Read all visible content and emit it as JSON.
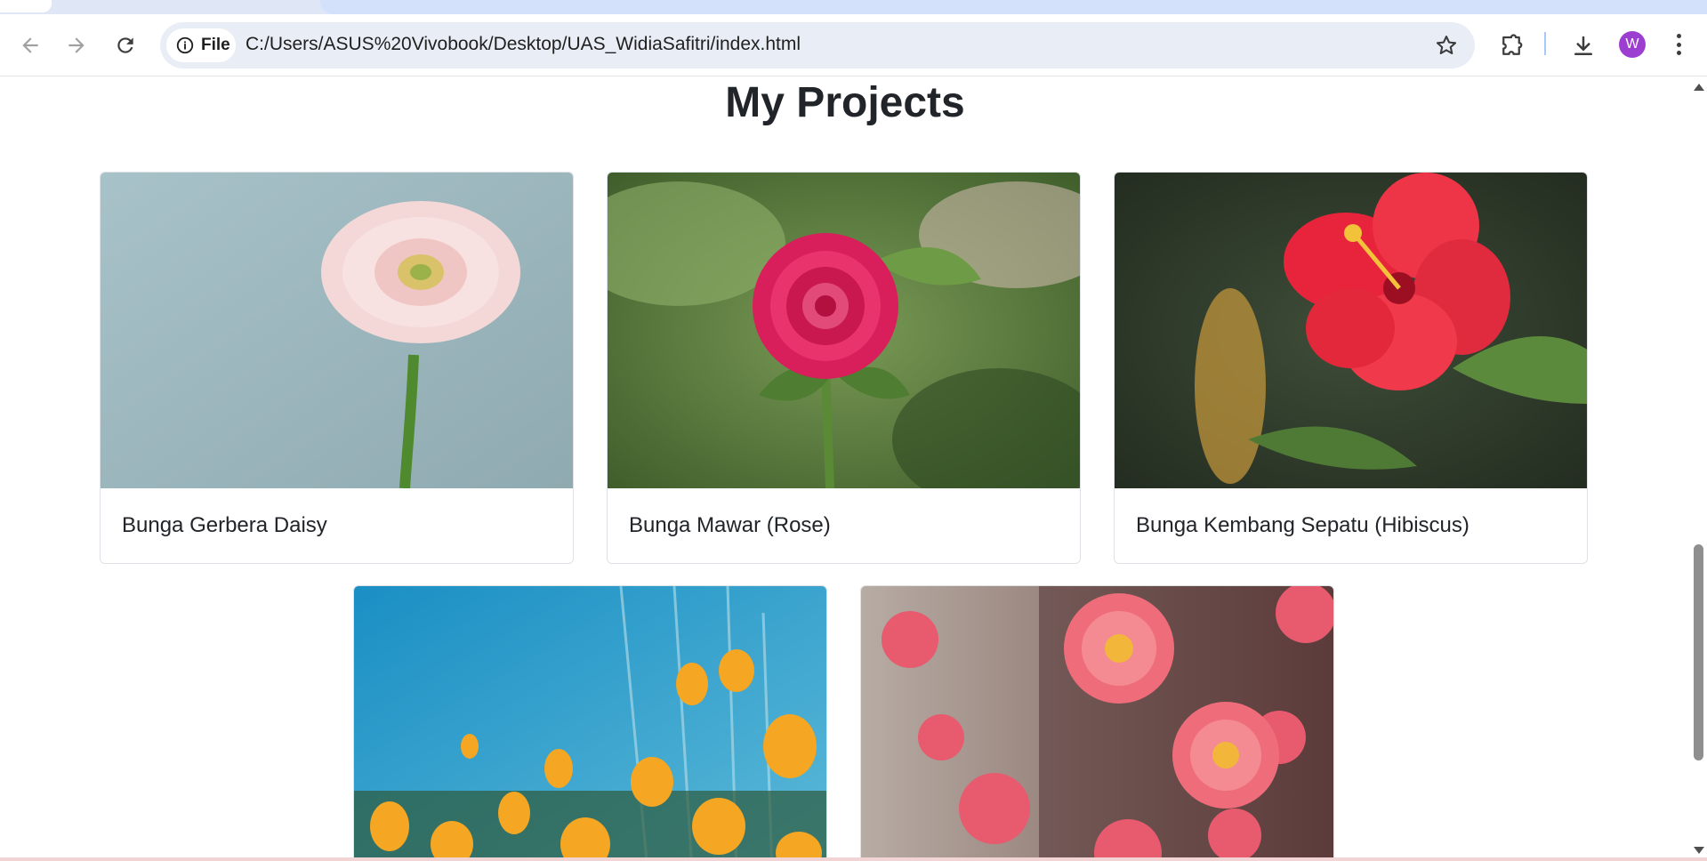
{
  "browser": {
    "site_chip_label": "File",
    "url": "C:/Users/ASUS%20Vivobook/Desktop/UAS_WidiaSafitri/index.html",
    "avatar_letter": "W",
    "accent_color": "#9c3fd1"
  },
  "page": {
    "title": "My Projects",
    "cards": [
      {
        "caption": "Bunga Gerbera Daisy",
        "image": "pink gerbera daisy on blue-gray background"
      },
      {
        "caption": "Bunga Mawar (Rose)",
        "image": "pink rose with green leaves"
      },
      {
        "caption": "Bunga Kembang Sepatu (Hibiscus)",
        "image": "red hibiscus flower"
      },
      {
        "caption": "",
        "image": "orange poppies under blue sky"
      },
      {
        "caption": "",
        "image": "pink peonies bouquet"
      }
    ]
  },
  "icons": {
    "back": "arrow-left-icon",
    "forward": "arrow-right-icon",
    "reload": "reload-icon",
    "info": "info-icon",
    "bookmark": "star-icon",
    "extensions": "puzzle-icon",
    "download": "download-icon",
    "menu": "more-vert-icon"
  }
}
